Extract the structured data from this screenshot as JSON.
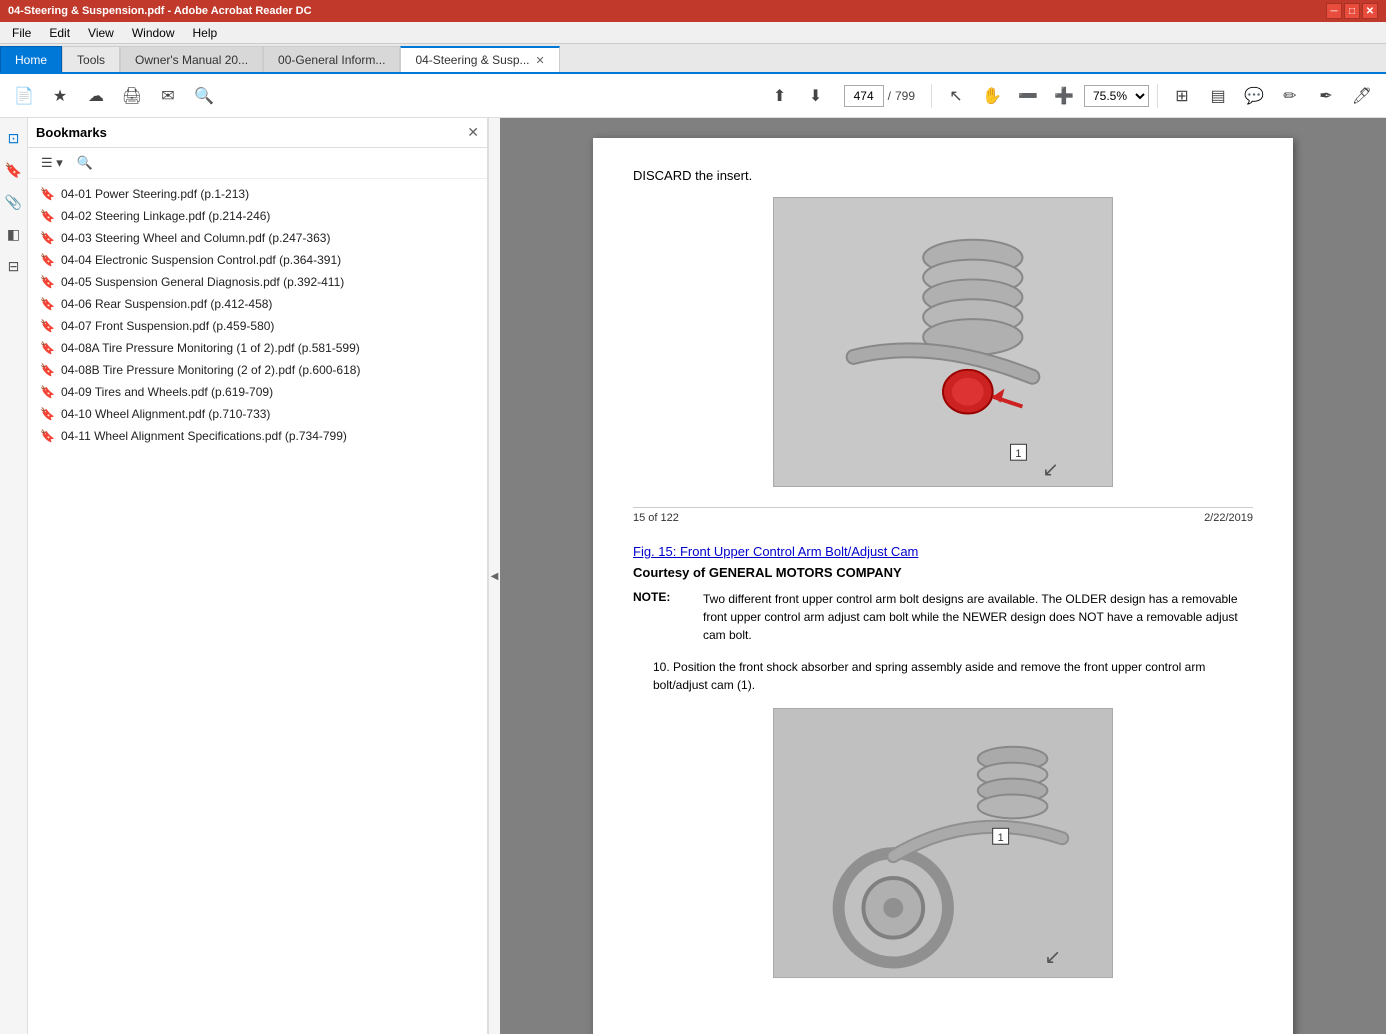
{
  "window": {
    "title": "04-Steering & Suspension.pdf - Adobe Acrobat Reader DC"
  },
  "menu": {
    "items": [
      "File",
      "Edit",
      "View",
      "Window",
      "Help"
    ]
  },
  "tabs": [
    {
      "label": "Home",
      "type": "home"
    },
    {
      "label": "Tools",
      "type": "tools"
    },
    {
      "label": "Owner's Manual 20...",
      "type": "normal"
    },
    {
      "label": "00-General Inform...",
      "type": "normal"
    },
    {
      "label": "04-Steering & Susp...",
      "type": "active",
      "closeable": true
    }
  ],
  "toolbar": {
    "page_current": "474",
    "page_total": "799",
    "zoom": "75.5%"
  },
  "bookmarks": {
    "title": "Bookmarks",
    "items": [
      "04-01 Power Steering.pdf (p.1-213)",
      "04-02 Steering Linkage.pdf (p.214-246)",
      "04-03 Steering Wheel and Column.pdf (p.247-363)",
      "04-04 Electronic Suspension Control.pdf (p.364-391)",
      "04-05 Suspension General Diagnosis.pdf (p.392-411)",
      "04-06 Rear Suspension.pdf (p.412-458)",
      "04-07 Front Suspension.pdf (p.459-580)",
      "04-08A Tire Pressure Monitoring (1 of 2).pdf (p.581-599)",
      "04-08B Tire Pressure Monitoring (2 of 2).pdf (p.600-618)",
      "04-09 Tires and Wheels.pdf (p.619-709)",
      "04-10 Wheel Alignment.pdf (p.710-733)",
      "04-11 Wheel Alignment Specifications.pdf (p.734-799)"
    ]
  },
  "pdf": {
    "discard_text": "DISCARD the insert.",
    "page_indicator": "15 of 122",
    "date": "2/22/2019",
    "fig_caption": "Fig. 15: Front Upper Control Arm Bolt/Adjust Cam",
    "fig_courtesy": "Courtesy of GENERAL MOTORS COMPANY",
    "note_label": "NOTE:",
    "note_text": "Two different front upper control arm bolt designs are available. The OLDER design has a removable front upper control arm adjust cam bolt while the NEWER design does NOT have a removable adjust cam bolt.",
    "step_number": "10.",
    "step_text": "Position the front shock absorber and spring assembly aside and remove the front upper control arm bolt/adjust cam (1)."
  }
}
